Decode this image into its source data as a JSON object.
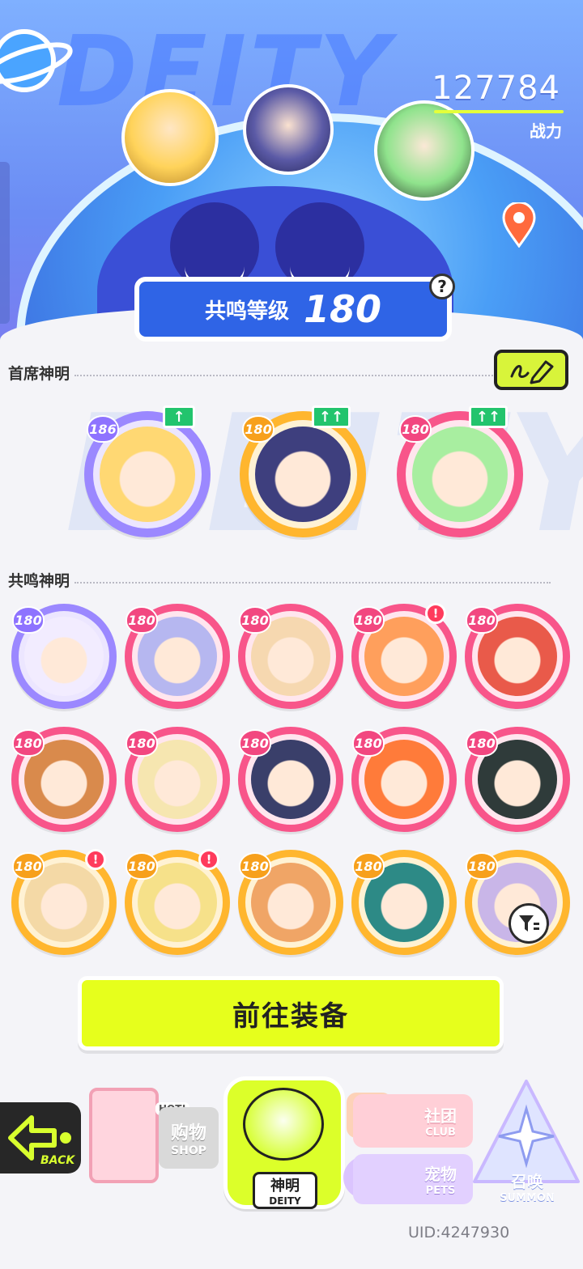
{
  "header": {
    "power_value": "127784",
    "power_label": "战力",
    "resonance_label": "共鸣等级",
    "resonance_level": "180",
    "help_symbol": "?"
  },
  "sections": {
    "chief_title": "首席神明",
    "resonance_title": "共鸣神明"
  },
  "chief_deities": [
    {
      "level": "186",
      "frame": "purple",
      "upgrade": "↑",
      "face": "#ffd873"
    },
    {
      "level": "180",
      "frame": "gold",
      "upgrade": "↑↑",
      "face": "#3e3f7e"
    },
    {
      "level": "180",
      "frame": "pink",
      "upgrade": "↑↑",
      "face": "#a8eea0"
    }
  ],
  "resonance_deities": [
    {
      "level": "180",
      "frame": "purple",
      "alert": false,
      "face": "#f2ecff"
    },
    {
      "level": "180",
      "frame": "pink",
      "alert": false,
      "face": "#b6b7f0"
    },
    {
      "level": "180",
      "frame": "pink",
      "alert": false,
      "face": "#f6d8b0"
    },
    {
      "level": "180",
      "frame": "pink",
      "alert": true,
      "face": "#ff9f5c"
    },
    {
      "level": "180",
      "frame": "pink",
      "alert": false,
      "face": "#e95a4a"
    },
    {
      "level": "180",
      "frame": "pink",
      "alert": false,
      "face": "#d98a4c"
    },
    {
      "level": "180",
      "frame": "pink",
      "alert": false,
      "face": "#f6e6b0"
    },
    {
      "level": "180",
      "frame": "pink",
      "alert": false,
      "face": "#3a3f6a"
    },
    {
      "level": "180",
      "frame": "pink",
      "alert": false,
      "face": "#ff7b3a"
    },
    {
      "level": "180",
      "frame": "pink",
      "alert": false,
      "face": "#2f3b3a"
    },
    {
      "level": "180",
      "frame": "gold",
      "alert": true,
      "face": "#f4d9a6"
    },
    {
      "level": "180",
      "frame": "gold",
      "alert": true,
      "face": "#f6e18a"
    },
    {
      "level": "180",
      "frame": "gold",
      "alert": false,
      "face": "#f0a566"
    },
    {
      "level": "180",
      "frame": "gold",
      "alert": false,
      "face": "#2d8a86"
    },
    {
      "level": "180",
      "frame": "gold",
      "alert": false,
      "face": "#c9b6e8"
    }
  ],
  "alert_symbol": "!",
  "equip_button": "前往装备",
  "nav": {
    "back_label": "BACK",
    "shop_cn": "购物",
    "shop_en": "SHOP",
    "shop_hot": "HOT!",
    "deity_cn": "神明",
    "deity_en": "DEITY",
    "club_cn": "社团",
    "club_en": "CLUB",
    "pets_cn": "宠物",
    "pets_en": "PETS",
    "summon_cn": "召唤",
    "summon_en": "SUMMON"
  },
  "uid": "UID:4247930",
  "watermark": "DEITY"
}
